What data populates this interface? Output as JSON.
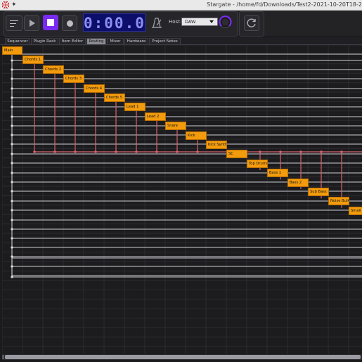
{
  "window": {
    "title": "Stargate - /home/fd/Downloads/Test2-2021-10-20T18-2",
    "app_icon": "flag-icon",
    "pin_icon": "pin-icon"
  },
  "transport": {
    "menu_icon": "hamburger-menu-icon",
    "play_icon": "play-icon",
    "stop_icon": "stop-icon",
    "record_icon": "record-icon",
    "clock": "0:00.0",
    "metronome_icon": "metronome-icon",
    "host_label": "Host:",
    "host_value": "DAW",
    "master_knob_icon": "volume-knob-icon",
    "refresh_icon": "refresh-icon",
    "colors": {
      "accent": "#7a2bf0",
      "clock_bg": "#0d0e6a",
      "clock_text": "#8c8ff2"
    }
  },
  "tabs": [
    {
      "label": "Sequencer",
      "active": false
    },
    {
      "label": "Plugin Rack",
      "active": false
    },
    {
      "label": "Item Editor",
      "active": false
    },
    {
      "label": "Routing",
      "active": true
    },
    {
      "label": "Mixer",
      "active": false
    },
    {
      "label": "Hardware",
      "active": false
    },
    {
      "label": "Project Notes",
      "active": false
    }
  ],
  "routing": {
    "tracks": [
      "Main",
      "Chords 1",
      "Chords 2",
      "Chords 3",
      "Chords 4",
      "Chords 5",
      "Lead 1",
      "Lead 2",
      "Snare",
      "Kick",
      "Kick Synth",
      "SC",
      "Top Drums",
      "Bass 1",
      "Bass 2",
      "Sub Bass",
      "Noise Bulk",
      "Small"
    ],
    "colors": {
      "node": "#f29b0d",
      "main_route": "#d9d9dd",
      "sidechain_route": "#d6646c"
    }
  }
}
